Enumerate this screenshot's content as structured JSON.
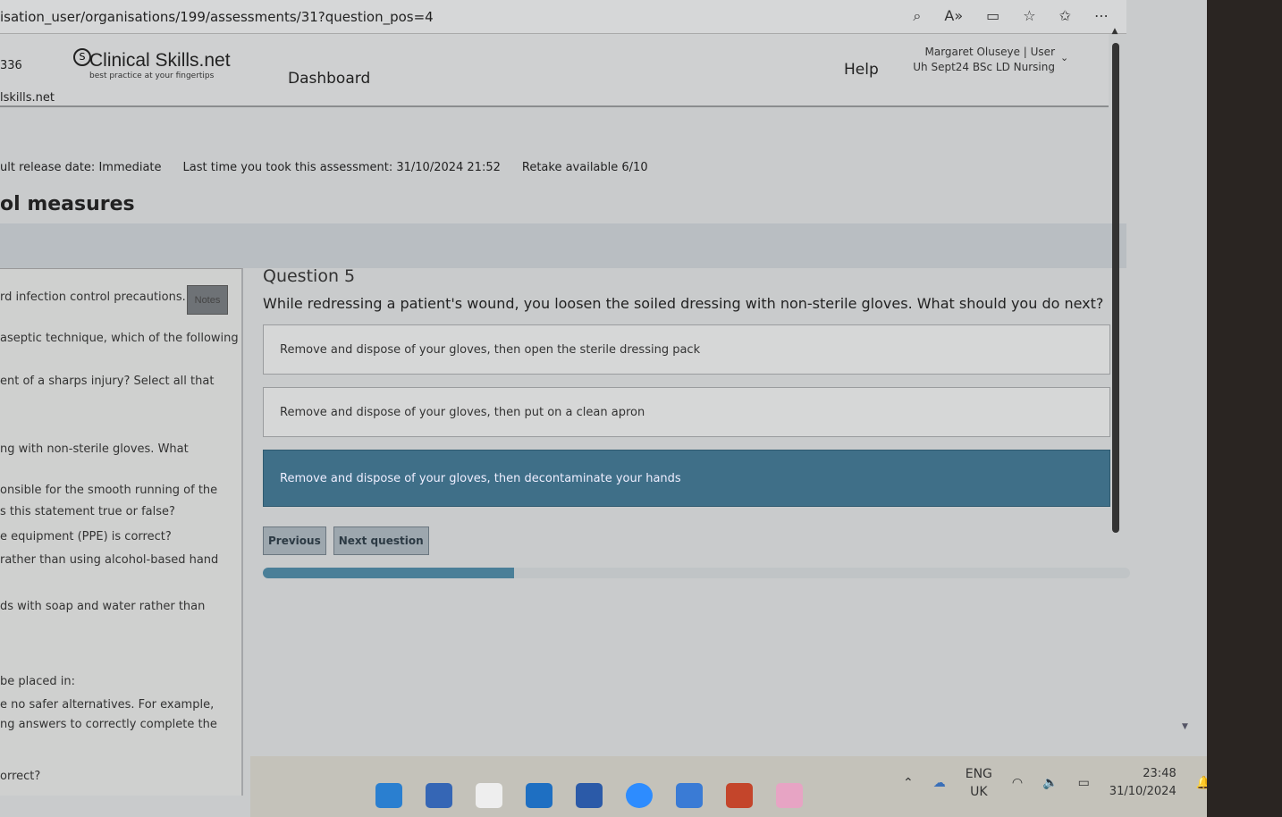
{
  "browser": {
    "url": "isation_user/organisations/199/assessments/31?question_pos=4",
    "icons": [
      "zoom-icon",
      "read-aloud-icon",
      "immersive-reader-icon",
      "favorite-icon",
      "favorites-bar-icon",
      "more-icon"
    ]
  },
  "header": {
    "left_fragment_1": "336",
    "left_fragment_2": "lskills.net",
    "logo_name": "Clinical Skills.net",
    "logo_tagline": "best practice at your fingertips",
    "nav_dashboard": "Dashboard",
    "nav_help": "Help",
    "user_name": "Margaret Oluseye | User",
    "user_org": "Uh Sept24 BSc LD Nursing"
  },
  "meta": {
    "release": "ult release date: Immediate",
    "last_taken": "Last time you took this assessment: 31/10/2024 21:52",
    "retake": "Retake available 6/10"
  },
  "page_title": "ol measures",
  "sidebar": {
    "notes_label": "Notes",
    "items": [
      "rd infection control precautions.",
      "aseptic technique, which of the following",
      "ent of a sharps injury? Select all that",
      "ng with non-sterile gloves. What",
      "onsible for the smooth running of the",
      "s this statement true or false?",
      "e equipment (PPE) is correct?",
      " rather than using alcohol-based hand",
      "ds with soap and water rather than",
      " be placed in:",
      "e no safer alternatives. For example,",
      "ng answers to correctly complete the",
      "orrect?"
    ]
  },
  "question": {
    "number": "Question 5",
    "text": "While redressing a patient's wound, you loosen the soiled dressing with non-sterile gloves. What should you do next?",
    "options": [
      "Remove and dispose of your gloves, then open the sterile dressing pack",
      "Remove and dispose of your gloves, then put on a clean apron",
      "Remove and dispose of your gloves, then decontaminate your hands"
    ],
    "selected_index": 2,
    "previous_label": "Previous",
    "next_label": "Next question",
    "progress_percent": 29
  },
  "colors": {
    "accent": "#3f6f88",
    "progress": "#4a7f98"
  },
  "taskbar": {
    "lang1": "ENG",
    "lang2": "UK",
    "time": "23:48",
    "date": "31/10/2024"
  }
}
